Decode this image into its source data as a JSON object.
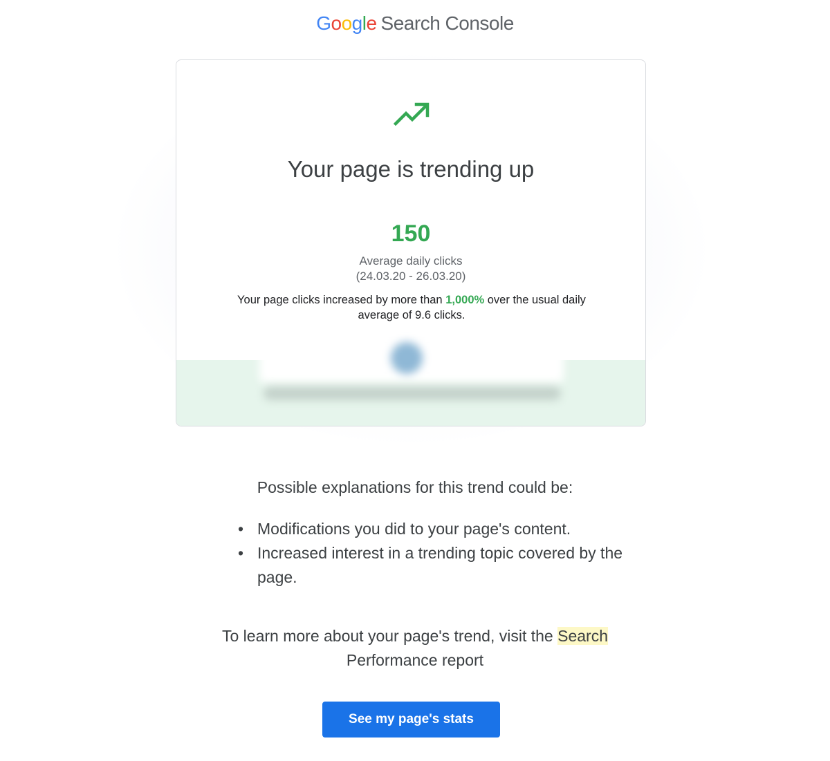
{
  "header": {
    "brand_letters": [
      "G",
      "o",
      "o",
      "g",
      "l",
      "e"
    ],
    "product": "Search Console"
  },
  "card": {
    "icon": "trending-up-icon",
    "title": "Your page is trending up",
    "metric_value": "150",
    "metric_label": "Average daily clicks",
    "metric_range": "(24.03.20 - 26.03.20)",
    "summary_prefix": "Your page clicks increased by more than ",
    "summary_highlight": "1,000%",
    "summary_suffix": " over the usual daily average of 9.6 clicks."
  },
  "explanations": {
    "heading": "Possible explanations for this trend could be:",
    "items": [
      "Modifications you did to your page's content.",
      "Increased interest in a trending topic covered by the page."
    ]
  },
  "learn_more": {
    "prefix": "To learn more about your page's trend, visit the ",
    "link_text": "Search",
    "suffix": " Performance report"
  },
  "cta": {
    "label": "See my page's stats"
  },
  "colors": {
    "trend_green": "#34a853",
    "accent_blue": "#1a73e8",
    "band_mint": "#e6f5ec",
    "link_highlight": "#fdf8c6"
  }
}
